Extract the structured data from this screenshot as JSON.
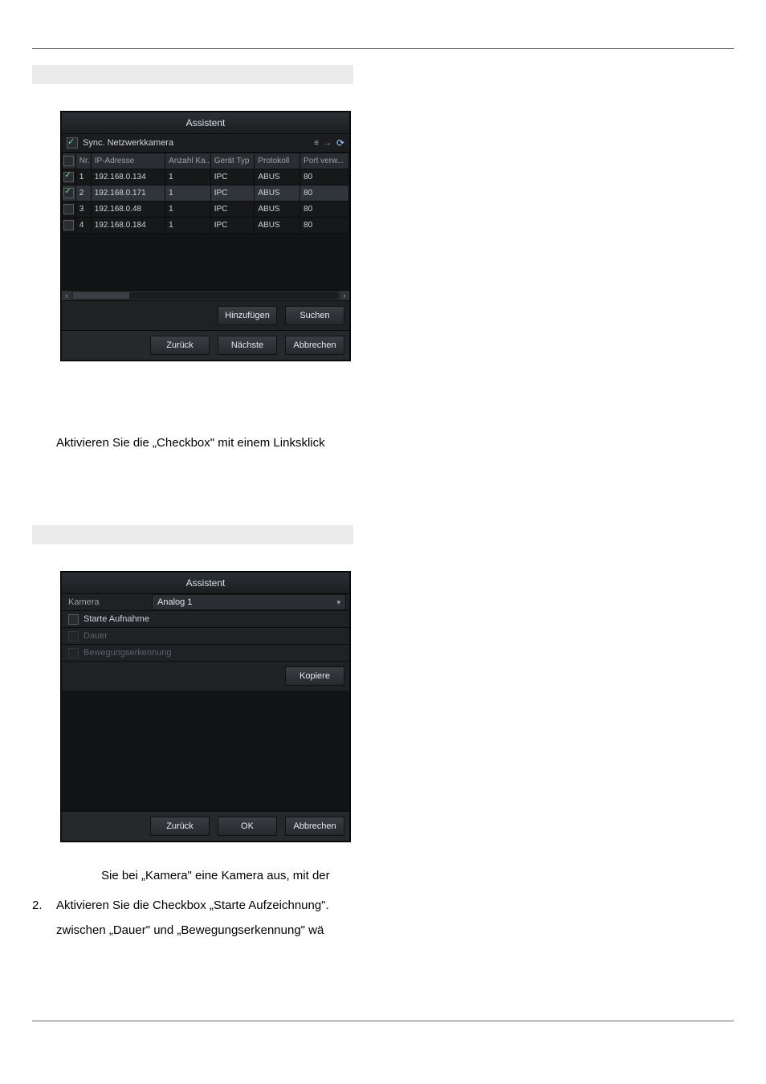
{
  "section1": {
    "instruction": "Aktivieren Sie die „Checkbox\" mit einem Linksklick"
  },
  "assist1": {
    "title": "Assistent",
    "sync": {
      "label": "Sync. Netzwerkkamera",
      "checked": true
    },
    "columns": {
      "nr": "Nr.",
      "ip": "IP-Adresse",
      "anzahl": "Anzahl Ka...",
      "typ": "Gerät Typ",
      "proto": "Protokoll",
      "port": "Port verw..."
    },
    "rows": [
      {
        "checked": true,
        "nr": "1",
        "ip": "192.168.0.134",
        "anzahl": "1",
        "typ": "IPC",
        "proto": "ABUS",
        "port": "80",
        "sel": false
      },
      {
        "checked": true,
        "nr": "2",
        "ip": "192.168.0.171",
        "anzahl": "1",
        "typ": "IPC",
        "proto": "ABUS",
        "port": "80",
        "sel": true
      },
      {
        "checked": false,
        "nr": "3",
        "ip": "192.168.0.48",
        "anzahl": "1",
        "typ": "IPC",
        "proto": "ABUS",
        "port": "80",
        "sel": false
      },
      {
        "checked": false,
        "nr": "4",
        "ip": "192.168.0.184",
        "anzahl": "1",
        "typ": "IPC",
        "proto": "ABUS",
        "port": "80",
        "sel": false
      }
    ],
    "btn_add": "Hinzufügen",
    "btn_search": "Suchen",
    "btn_back": "Zurück",
    "btn_next": "Nächste",
    "btn_cancel": "Abbrechen"
  },
  "assist2": {
    "title": "Assistent",
    "kamera_label": "Kamera",
    "kamera_value": "Analog 1",
    "start_aufnahme": "Starte Aufnahme",
    "dauer": "Dauer",
    "bewegung": "Bewegungserkennung",
    "btn_copy": "Kopiere",
    "btn_back": "Zurück",
    "btn_ok": "OK",
    "btn_cancel": "Abbrechen"
  },
  "section2": {
    "line1": "Sie bei „Kamera\" eine Kamera aus, mit der",
    "step2_num": "2.",
    "step2_text": "Aktivieren Sie die Checkbox „Starte Aufzeichnung\".",
    "line3": "zwischen „Dauer\" und „Bewegungserkennung\" wä"
  }
}
